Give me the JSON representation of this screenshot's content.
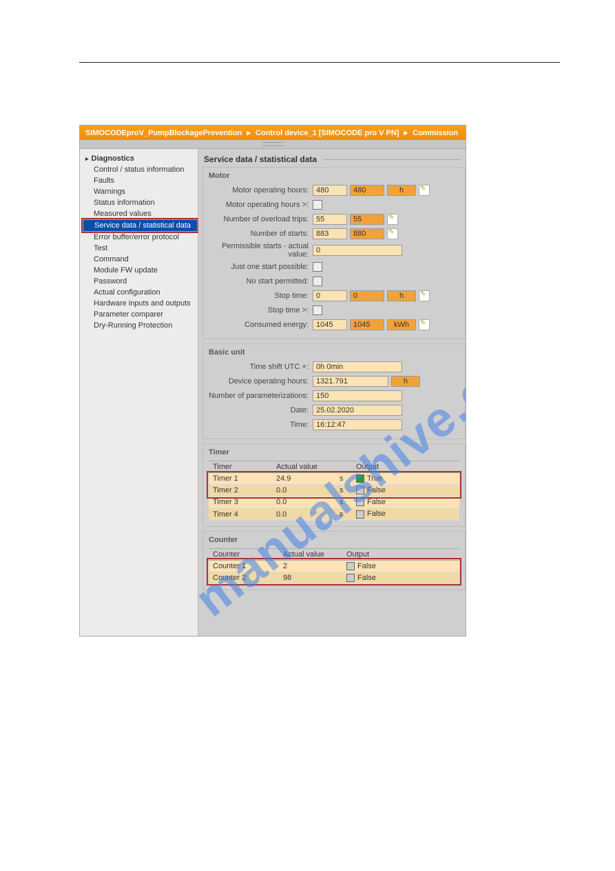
{
  "watermark": "manualshive.com",
  "breadcrumb": {
    "a": "SIMOCODEproV_PumpBlockagePrevention",
    "b": "Control device_1 [SIMOCODE pro V PN]",
    "c": "Commission"
  },
  "nav": {
    "head": "Diagnostics",
    "items": [
      "Control / status information",
      "Faults",
      "Warnings",
      "Status information",
      "Measured values",
      "Service data / statistical data",
      "Error buffer/error protocol",
      "Test",
      "Command",
      "Module FW update",
      "Password",
      "Actual configuration",
      "Hardware inputs and outputs",
      "Parameter comparer",
      "Dry-Running Protection"
    ],
    "selected_index": 5
  },
  "page_title": "Service data / statistical data",
  "motor": {
    "title": "Motor",
    "rows": {
      "op_hours_l": "Motor operating hours:",
      "op_hours_1": "480",
      "op_hours_2": "480",
      "op_hours_u": "h",
      "op_hours_gt_l": "Motor operating hours >:",
      "ovl_trips_l": "Number of overload trips:",
      "ovl_trips_1": "55",
      "ovl_trips_2": "55",
      "starts_l": "Number of starts:",
      "starts_1": "883",
      "starts_2": "880",
      "perm_starts_l": "Permissible starts - actual value:",
      "perm_starts_1": "0",
      "one_start_l": "Just one start possible:",
      "no_start_l": "No start permitted:",
      "stop_time_l": "Stop time:",
      "stop_time_1": "0",
      "stop_time_2": "0",
      "stop_time_u": "h",
      "stop_time_gt_l": "Stop time >:",
      "energy_l": "Consumed energy:",
      "energy_1": "1045",
      "energy_2": "1045",
      "energy_u": "kWh"
    }
  },
  "basic": {
    "title": "Basic unit",
    "time_shift_l": "Time shift UTC +:",
    "time_shift": "0h 0min",
    "dev_hours_l": "Device operating hours:",
    "dev_hours": "1321.791",
    "dev_hours_u": "h",
    "param_l": "Number of parameterizations:",
    "param": "150",
    "date_l": "Date:",
    "date": "25.02.2020",
    "time_l": "Time:",
    "time": "16:12:47"
  },
  "timer": {
    "title": "Timer",
    "h1": "Timer",
    "h2": "Actual value",
    "h3": "Output",
    "rows": [
      {
        "name": "Timer 1",
        "value": "24.9",
        "u": "s",
        "out": "True",
        "on": true
      },
      {
        "name": "Timer 2",
        "value": "0.0",
        "u": "s",
        "out": "False",
        "on": false
      },
      {
        "name": "Timer 3",
        "value": "0.0",
        "u": "s",
        "out": "False",
        "on": false
      },
      {
        "name": "Timer 4",
        "value": "0.0",
        "u": "s",
        "out": "False",
        "on": false
      }
    ]
  },
  "counter": {
    "title": "Counter",
    "h1": "Counter",
    "h2": "Actual value",
    "h3": "Output",
    "rows": [
      {
        "name": "Counter 1",
        "value": "2",
        "out": "False"
      },
      {
        "name": "Counter 2",
        "value": "98",
        "out": "False"
      }
    ]
  }
}
